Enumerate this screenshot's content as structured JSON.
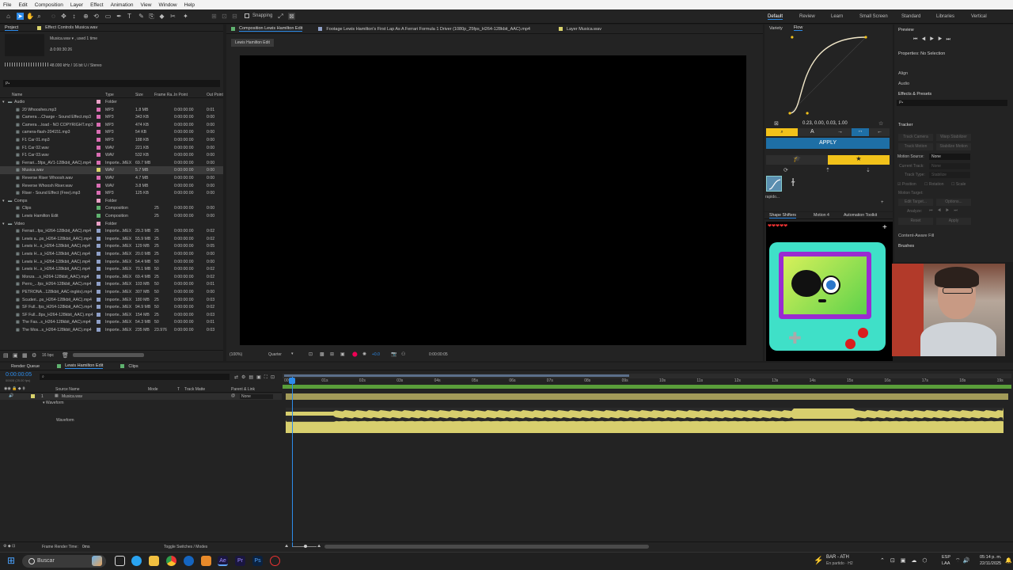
{
  "menu": [
    "File",
    "Edit",
    "Composition",
    "Layer",
    "Effect",
    "Animation",
    "View",
    "Window",
    "Help"
  ],
  "toolbar": {
    "snapping": "Snapping",
    "workspaces": [
      "Default",
      "Review",
      "Learn",
      "Small Screen",
      "Standard",
      "Libraries",
      "Vertical"
    ]
  },
  "project": {
    "tab": "Project",
    "effect_tab": "Effect Controls Musica.wav",
    "item_name": "Musica.wav ▾ , used 1 time",
    "item_duration": "Δ 0:00:30:26",
    "item_audio": "48.000 kHz / 16 bit U / Stereo",
    "search_placeholder": "Ρ•",
    "columns": [
      "Name",
      "Type",
      "Size",
      "Frame Ra...",
      "In Point",
      "Out Point"
    ],
    "rows": [
      {
        "name": "Audio",
        "type": "Folder",
        "size": "",
        "fr": "",
        "in": "",
        "out": "",
        "color": "#e9a0c6",
        "level": 0,
        "folder": true
      },
      {
        "name": "20 Whooshes.mp3",
        "type": "MP3",
        "size": "1.8 MB",
        "fr": "",
        "in": "0:00:00:00",
        "out": "0:01",
        "color": "#d96db3",
        "level": 1
      },
      {
        "name": "Camera ...Charge - Sound Effect.mp3",
        "type": "MP3",
        "size": "343 KB",
        "fr": "",
        "in": "0:00:00:00",
        "out": "0:00",
        "color": "#d96db3",
        "level": 1
      },
      {
        "name": "Camera ...load - NO COPYRIGHT.mp3",
        "type": "MP3",
        "size": "474 KB",
        "fr": "",
        "in": "0:00:00:00",
        "out": "0:00",
        "color": "#d96db3",
        "level": 1
      },
      {
        "name": "camera-flash-204151.mp3",
        "type": "MP3",
        "size": "54 KB",
        "fr": "",
        "in": "0:00:00:00",
        "out": "0:00",
        "color": "#d96db3",
        "level": 1
      },
      {
        "name": "F1 Car 01.mp3",
        "type": "MP3",
        "size": "188 KB",
        "fr": "",
        "in": "0:00:00:00",
        "out": "0:00",
        "color": "#d96db3",
        "level": 1
      },
      {
        "name": "F1 Car 02.wav",
        "type": "WAV",
        "size": "221 KB",
        "fr": "",
        "in": "0:00:00:00",
        "out": "0:00",
        "color": "#d96db3",
        "level": 1
      },
      {
        "name": "F1 Car 03.wav",
        "type": "WAV",
        "size": "532 KB",
        "fr": "",
        "in": "0:00:00:00",
        "out": "0:00",
        "color": "#d96db3",
        "level": 1
      },
      {
        "name": "Ferrari...5fps_AV1-128kbit_AAC).mp4",
        "type": "Importe...MEX",
        "size": "69.7 MB",
        "fr": "",
        "in": "0:00:00:00",
        "out": "0:00",
        "color": "#d96db3",
        "level": 1
      },
      {
        "name": "Musica.wav",
        "type": "WAV",
        "size": "5.7 MB",
        "fr": "",
        "in": "0:00:00:00",
        "out": "0:00",
        "color": "#d9d36c",
        "level": 1,
        "selected": true
      },
      {
        "name": "Reverse Riser Whoosh.wav",
        "type": "WAV",
        "size": "4.7 MB",
        "fr": "",
        "in": "0:00:00:00",
        "out": "0:00",
        "color": "#d96db3",
        "level": 1
      },
      {
        "name": "Reverse Whoosh Riser.wav",
        "type": "WAV",
        "size": "3.8 MB",
        "fr": "",
        "in": "0:00:00:00",
        "out": "0:00",
        "color": "#d96db3",
        "level": 1
      },
      {
        "name": "Riser - Sound Effect (Free).mp3",
        "type": "MP3",
        "size": "125 KB",
        "fr": "",
        "in": "0:00:00:00",
        "out": "0:00",
        "color": "#d96db3",
        "level": 1
      },
      {
        "name": "Comps",
        "type": "Folder",
        "size": "",
        "fr": "",
        "in": "",
        "out": "",
        "color": "#e9a0c6",
        "level": 0,
        "folder": true
      },
      {
        "name": "Clips",
        "type": "Composition",
        "size": "",
        "fr": "25",
        "in": "0:00:00:00",
        "out": "0:00",
        "color": "#5fb26f",
        "level": 1
      },
      {
        "name": "Lewis Hamilton Edit",
        "type": "Composition",
        "size": "",
        "fr": "25",
        "in": "0:00:00:00",
        "out": "0:00",
        "color": "#5fb26f",
        "level": 1
      },
      {
        "name": "Video",
        "type": "Folder",
        "size": "",
        "fr": "",
        "in": "",
        "out": "",
        "color": "#e9a0c6",
        "level": 0,
        "folder": true
      },
      {
        "name": "Ferrari...fps_H264-128kbit_AAC).mp4",
        "type": "Importe...MEX",
        "size": "29.3 MB",
        "fr": "25",
        "in": "0:00:00:00",
        "out": "0:02",
        "color": "#8fa0c8",
        "level": 1
      },
      {
        "name": "Lewis a...ps_H264-128kbit_AAC).mp4",
        "type": "Importe...MEX",
        "size": "55.9 MB",
        "fr": "25",
        "in": "0:00:00:00",
        "out": "0:02",
        "color": "#8fa0c8",
        "level": 1
      },
      {
        "name": "Lewis H...s_H264-128kbit_AAC).mp4",
        "type": "Importe...MEX",
        "size": "129 MB",
        "fr": "25",
        "in": "0:00:00:00",
        "out": "0:05",
        "color": "#8fa0c8",
        "level": 1
      },
      {
        "name": "Lewis H...s_H264-128kbit_AAC).mp4",
        "type": "Importe...MEX",
        "size": "20.0 MB",
        "fr": "25",
        "in": "0:00:00:00",
        "out": "0:00",
        "color": "#8fa0c8",
        "level": 1
      },
      {
        "name": "Lewis H...s_H264-128kbit_AAC).mp4",
        "type": "Importe...MEX",
        "size": "54.4 MB",
        "fr": "50",
        "in": "0:00:00:00",
        "out": "0:00",
        "color": "#8fa0c8",
        "level": 1
      },
      {
        "name": "Lewis H...s_H264-128kbit_AAC).mp4",
        "type": "Importe...MEX",
        "size": "70.1 MB",
        "fr": "50",
        "in": "0:00:00:00",
        "out": "0:02",
        "color": "#8fa0c8",
        "level": 1
      },
      {
        "name": "Monza ...s_H264-128kbit_AAC).mp4",
        "type": "Importe...MEX",
        "size": "69.4 MB",
        "fr": "25",
        "in": "0:00:00:00",
        "out": "0:02",
        "color": "#8fa0c8",
        "level": 1
      },
      {
        "name": "Perro_...fps_H264-128kbit_AAC).mp4",
        "type": "Importe...MEX",
        "size": "103 MB",
        "fr": "50",
        "in": "0:00:00:00",
        "out": "0:01",
        "color": "#8fa0c8",
        "level": 1
      },
      {
        "name": "PETRONA...128kbit_AAC-inglés).mp4",
        "type": "Importe...MEX",
        "size": "307 MB",
        "fr": "50",
        "in": "0:00:00:00",
        "out": "0:00",
        "color": "#8fa0c8",
        "level": 1
      },
      {
        "name": "Scuderi...ps_H264-128kbit_AAC).mp4",
        "type": "Importe...MEX",
        "size": "180 MB",
        "fr": "25",
        "in": "0:00:00:00",
        "out": "0:03",
        "color": "#8fa0c8",
        "level": 1
      },
      {
        "name": "SF Full...fps_H264-128kbit_AAC).mp4",
        "type": "Importe...MEX",
        "size": "94.9 MB",
        "fr": "50",
        "in": "0:00:00:00",
        "out": "0:02",
        "color": "#8fa0c8",
        "level": 1
      },
      {
        "name": "SF Full...8ps_H264-128kbit_AAC).mp4",
        "type": "Importe...MEX",
        "size": "154 MB",
        "fr": "25",
        "in": "0:00:00:00",
        "out": "0:03",
        "color": "#8fa0c8",
        "level": 1
      },
      {
        "name": "The Fas...s_H264-128kbit_AAC).mp4",
        "type": "Importe...MEX",
        "size": "54.3 MB",
        "fr": "50",
        "in": "0:00:00:00",
        "out": "0:01",
        "color": "#8fa0c8",
        "level": 1
      },
      {
        "name": "The Mos...s_H264-128kbit_AAC).mp4",
        "type": "Importe...MEX",
        "size": "235 MB",
        "fr": "23.976",
        "in": "0:00:00:00",
        "out": "0:03",
        "color": "#8fa0c8",
        "level": 1
      }
    ],
    "bpc": "16 bpc"
  },
  "viewer": {
    "tabs": [
      "Composition Lewis Hamilton Edit",
      "Footage Lewis Hamilton's First Lap As A Ferrari Formula 1 Driver (1080p_25fps_H264-128kbit_AAC).mp4",
      "Layer Musica.wav"
    ],
    "breadcrumb": "Lewis Hamilton Edit",
    "zoom": "(100%)",
    "resolution": "Quarter",
    "exposure": "+0.0",
    "timecode": "0:00:00:05"
  },
  "flow": {
    "tabs": [
      "Variety",
      "Flow"
    ],
    "values": "0.23, 0.00, 0.03, 1.00",
    "apply": "APPLY",
    "preset_label": "rapido...",
    "curve": [
      0.23,
      0.0,
      0.03,
      1.0
    ]
  },
  "shapeshifters": {
    "tabs": [
      "Shape Shifters",
      "Motion 4",
      "Automation Toolkit"
    ]
  },
  "preview": {
    "title": "Preview",
    "properties": "Properties: No Selection",
    "align": "Align",
    "audio": "Audio",
    "effects": "Effects & Presets",
    "search": "Ρ•",
    "tracker": {
      "title": "Tracker",
      "track_camera": "Track Camera",
      "warp": "Warp Stabilizer",
      "track_motion": "Track Motion",
      "stabilize": "Stabilize Motion",
      "motion_source_label": "Motion Source:",
      "motion_source": "None",
      "current_track_label": "Current Track:",
      "current_track": "None",
      "track_type_label": "Track Type:",
      "track_type": "Stabilize",
      "position": "Position",
      "rotation": "Rotation",
      "scale": "Scale",
      "motion_target": "Motion Target:",
      "edit_target": "Edit Target...",
      "options": "Options...",
      "analyze": "Analyze:",
      "reset": "Reset",
      "apply": "Apply"
    },
    "content_aware": "Content-Aware Fill",
    "brushes": "Brushes"
  },
  "timeline": {
    "tabs": [
      "Render Queue",
      "Lewis Hamilton Edit",
      "Clips"
    ],
    "timecode": "0:00:00:05",
    "fps": "00005 (25.00 fps)",
    "cols": [
      "Source Name",
      "Mode",
      "T",
      "Track Matte",
      "Parent & Link"
    ],
    "layer_num": "1",
    "layer_name": "Musica.wav",
    "parent": "None",
    "waveform": "Waveform",
    "waveform_sub": "Waveform",
    "ruler": [
      "00f",
      "01s",
      "02s",
      "03s",
      "04s",
      "05s",
      "06s",
      "07s",
      "08s",
      "09s",
      "10s",
      "11s",
      "12s",
      "13s",
      "14s",
      "15s",
      "16s",
      "17s",
      "18s",
      "19s"
    ],
    "render_time_label": "Frame Render Time:",
    "render_time": "0ms",
    "toggle": "Toggle Switches / Modes"
  },
  "taskbar": {
    "search": "Buscar",
    "weather_title": "BAR - ATH",
    "weather_sub": "En partido · H2",
    "lang": "ESP",
    "lang2": "LAA",
    "time": "05:14 p. m.",
    "date": "22/11/2025"
  },
  "colors": {
    "accent": "#2d8ceb",
    "apply_blue": "#1e6fa6",
    "flow_yellow": "#f2c21a",
    "waveform": "#d8cf6e",
    "track_green": "#5a9e3a"
  }
}
